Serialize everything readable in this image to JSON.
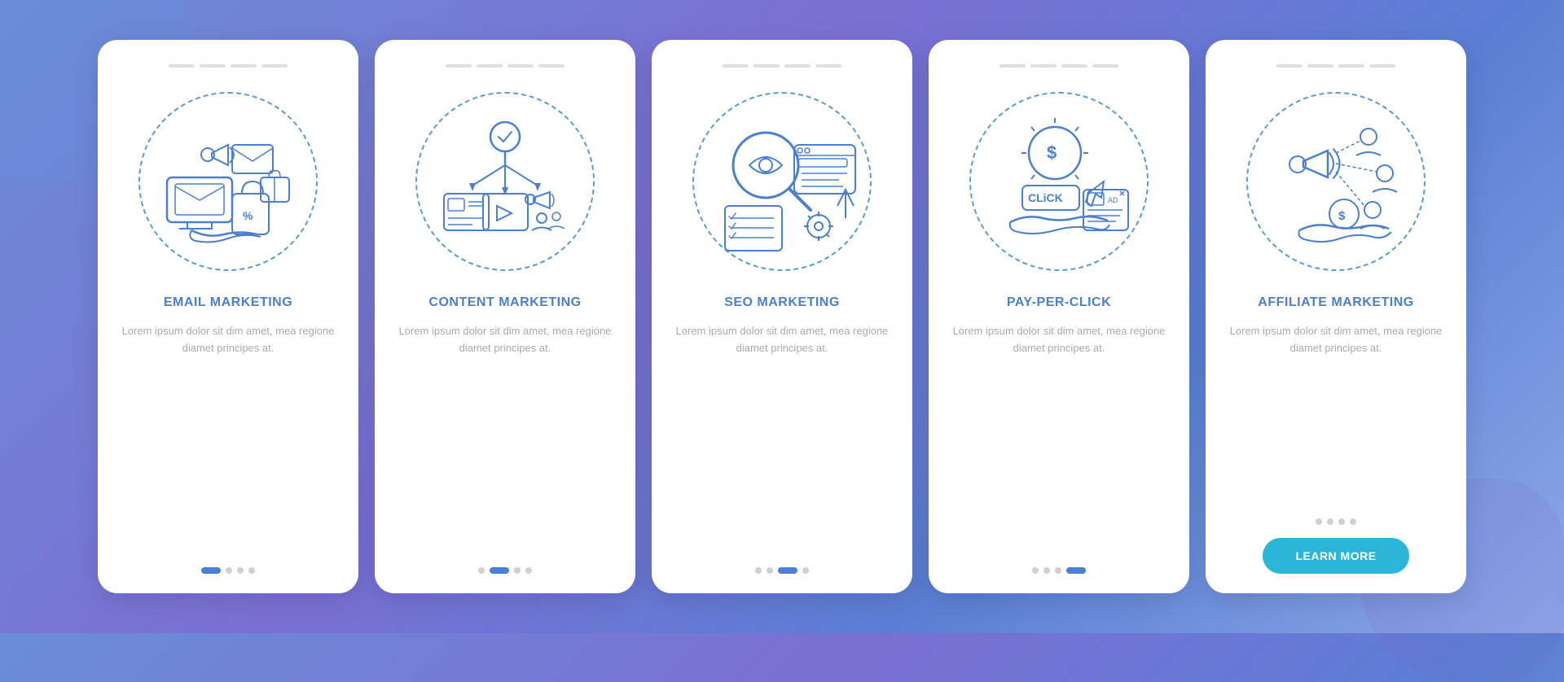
{
  "background": {
    "gradient_start": "#6b8dd6",
    "gradient_end": "#7b6fd4"
  },
  "cards": [
    {
      "id": "email-marketing",
      "title": "EMAIL MARKETING",
      "description": "Lorem ipsum dolor sit dim amet, mea regione diamet principes at.",
      "nav_dots": [
        {
          "active": true
        },
        {
          "active": false
        },
        {
          "active": false
        },
        {
          "active": false
        }
      ],
      "top_dots_count": 4,
      "has_button": false
    },
    {
      "id": "content-marketing",
      "title": "CONTENT MARKETING",
      "description": "Lorem ipsum dolor sit dim amet, mea regione diamet principes at.",
      "nav_dots": [
        {
          "active": false
        },
        {
          "active": true
        },
        {
          "active": false
        },
        {
          "active": false
        }
      ],
      "top_dots_count": 4,
      "has_button": false
    },
    {
      "id": "seo-marketing",
      "title": "SEO MARKETING",
      "description": "Lorem ipsum dolor sit dim amet, mea regione diamet principes at.",
      "nav_dots": [
        {
          "active": false
        },
        {
          "active": false
        },
        {
          "active": true
        },
        {
          "active": false
        }
      ],
      "top_dots_count": 4,
      "has_button": false
    },
    {
      "id": "pay-per-click",
      "title": "PAY-PER-CLICK",
      "description": "Lorem ipsum dolor sit dim amet, mea regione diamet principes at.",
      "nav_dots": [
        {
          "active": false
        },
        {
          "active": false
        },
        {
          "active": false
        },
        {
          "active": true
        }
      ],
      "top_dots_count": 4,
      "has_button": false
    },
    {
      "id": "affiliate-marketing",
      "title": "AFFILIATE MARKETING",
      "description": "Lorem ipsum dolor sit dim amet, mea regione diamet principes at.",
      "nav_dots": [
        {
          "active": false
        },
        {
          "active": false
        },
        {
          "active": false
        },
        {
          "active": false
        }
      ],
      "top_dots_count": 4,
      "has_button": true,
      "button_label": "LEARN MORE"
    }
  ],
  "lorem_text": "Lorem ipsum dolor sit dim amet, mea regione diamet principes at."
}
